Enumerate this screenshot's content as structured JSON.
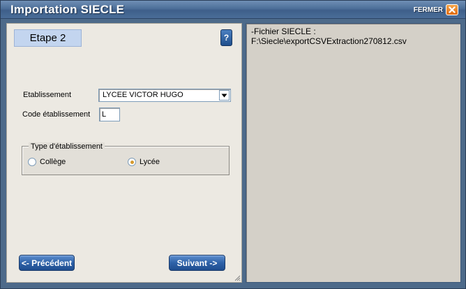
{
  "window": {
    "title": "Importation SIECLE",
    "close_label": "FERMER"
  },
  "step": {
    "label": "Etape 2",
    "help_label": "?"
  },
  "form": {
    "etablissement_label": "Etablissement",
    "etablissement_value": "LYCEE VICTOR HUGO",
    "code_label": "Code établissement",
    "code_value": "L",
    "type_group_label": "Type d'établissement",
    "type_options": [
      {
        "label": "Collège",
        "selected": false
      },
      {
        "label": "Lycée",
        "selected": true
      }
    ]
  },
  "buttons": {
    "previous_label": "<- Précédent",
    "next_label": "Suivant ->"
  },
  "info_panel": {
    "text": "-Fichier SIECLE :\nF:\\Siecle\\exportCSVExtraction270812.csv"
  },
  "colors": {
    "accent_blue": "#2e62a8",
    "close_orange": "#e06a10",
    "radio_selected": "#d59a2f",
    "step_box": "#c3d5ef"
  }
}
